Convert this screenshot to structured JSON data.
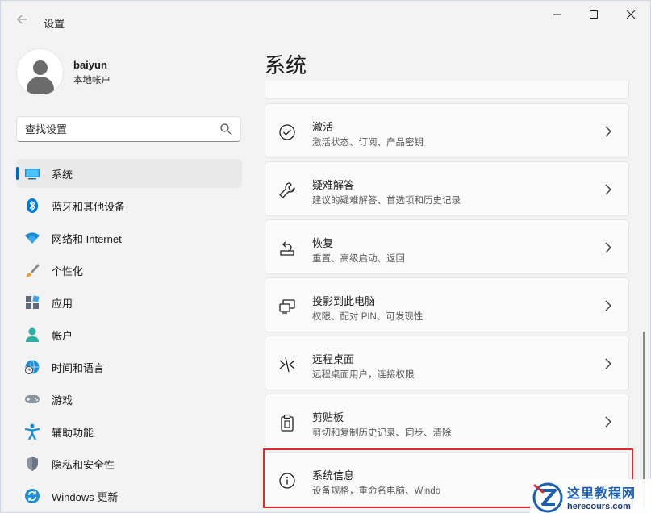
{
  "window": {
    "title": "设置",
    "controls": {
      "minimize": "—",
      "maximize": "☐",
      "close": "✕"
    }
  },
  "profile": {
    "name": "baiyun",
    "type": "本地帐户"
  },
  "search": {
    "placeholder": "查找设置"
  },
  "sidebar": {
    "items": [
      {
        "label": "系统",
        "icon": "system-display-icon",
        "active": true
      },
      {
        "label": "蓝牙和其他设备",
        "icon": "bluetooth-icon"
      },
      {
        "label": "网络和 Internet",
        "icon": "wifi-icon"
      },
      {
        "label": "个性化",
        "icon": "brush-icon"
      },
      {
        "label": "应用",
        "icon": "apps-icon"
      },
      {
        "label": "帐户",
        "icon": "account-icon"
      },
      {
        "label": "时间和语言",
        "icon": "globe-clock-icon"
      },
      {
        "label": "游戏",
        "icon": "gamepad-icon"
      },
      {
        "label": "辅助功能",
        "icon": "accessibility-icon"
      },
      {
        "label": "隐私和安全性",
        "icon": "shield-icon"
      },
      {
        "label": "Windows 更新",
        "icon": "update-icon"
      }
    ]
  },
  "main": {
    "title": "系统",
    "cards": [
      {
        "title": "激活",
        "subtitle": "激活状态、订阅、产品密钥",
        "icon": "check-circle-icon"
      },
      {
        "title": "疑难解答",
        "subtitle": "建议的疑难解答、首选项和历史记录",
        "icon": "wrench-icon"
      },
      {
        "title": "恢复",
        "subtitle": "重置、高级启动、返回",
        "icon": "recovery-icon"
      },
      {
        "title": "投影到此电脑",
        "subtitle": "权限、配对 PIN、可发现性",
        "icon": "project-icon"
      },
      {
        "title": "远程桌面",
        "subtitle": "远程桌面用户，连接权限",
        "icon": "remote-desktop-icon"
      },
      {
        "title": "剪贴板",
        "subtitle": "剪切和复制历史记录、同步、清除",
        "icon": "clipboard-icon"
      },
      {
        "title": "系统信息",
        "subtitle": "设备规格，重命名电脑、Windo",
        "icon": "info-icon",
        "highlighted": true
      }
    ]
  },
  "watermark": {
    "title": "这里教程网",
    "url": "herecours.com"
  },
  "colors": {
    "accent": "#0067c0",
    "highlight": "#d62d2d"
  }
}
